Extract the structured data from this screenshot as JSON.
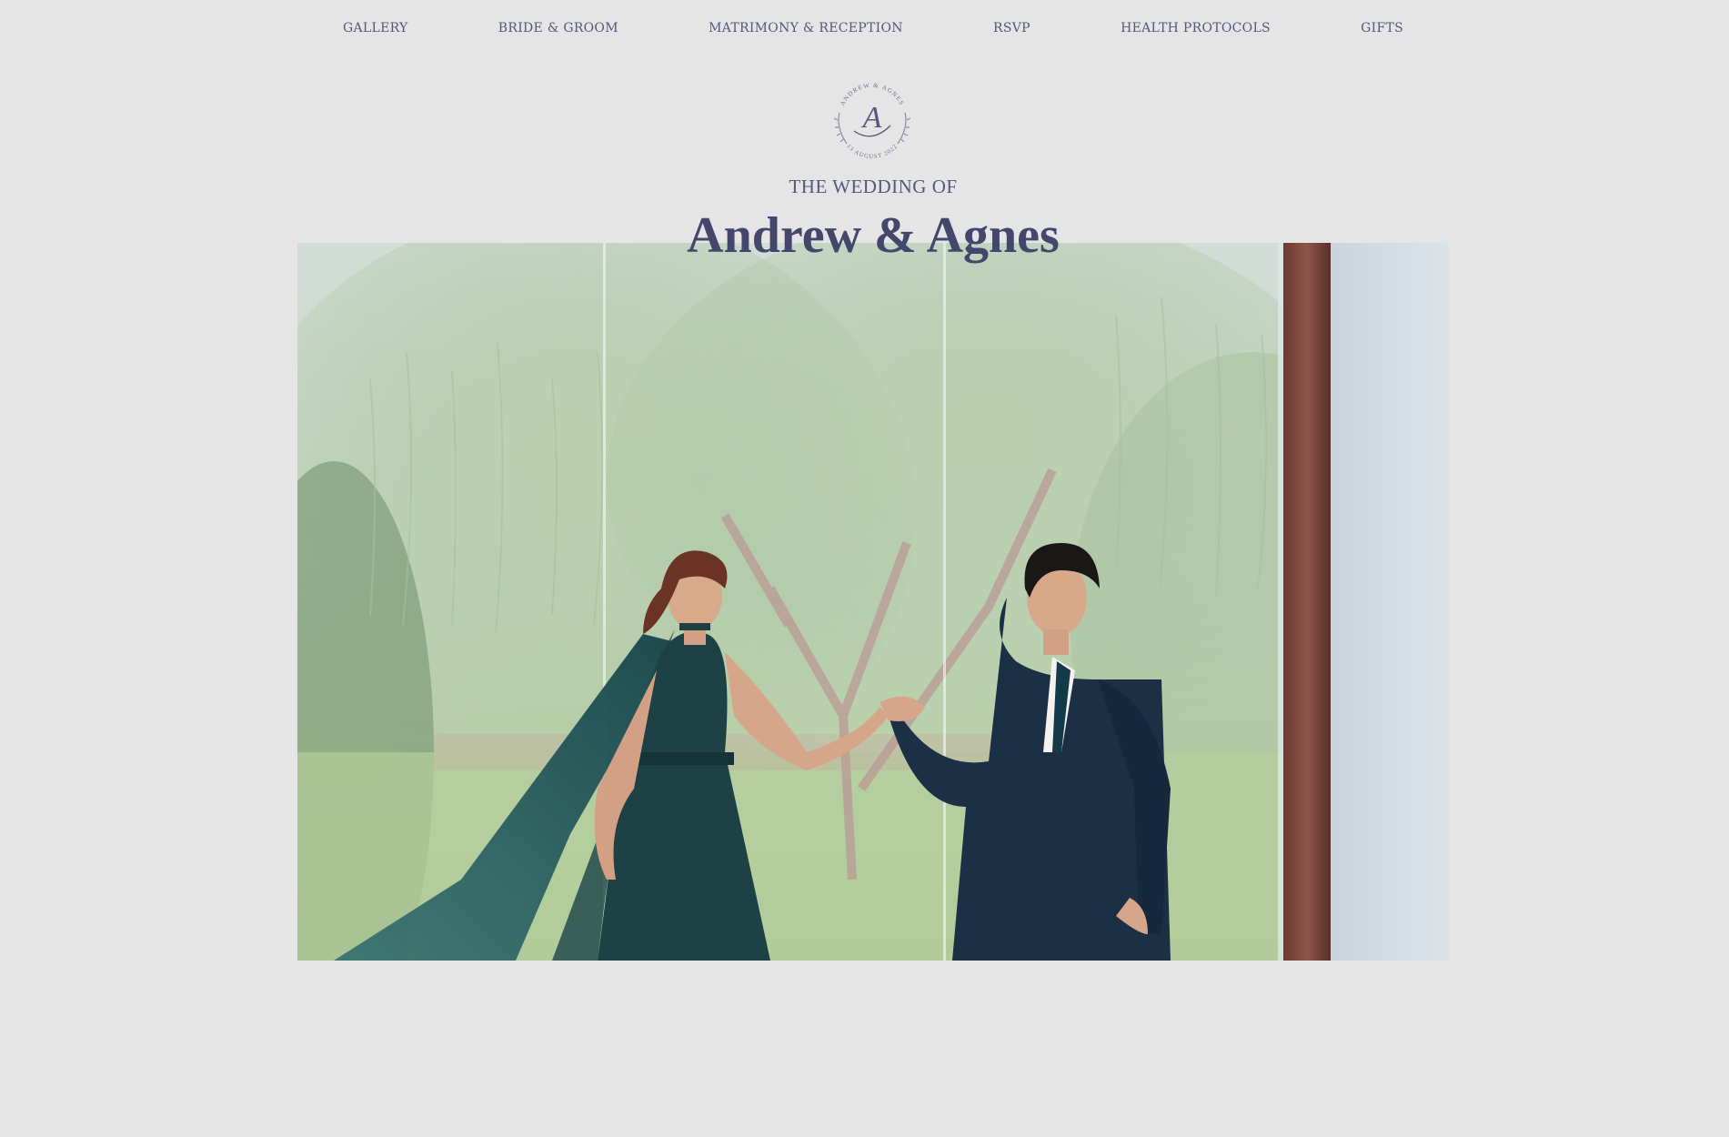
{
  "nav": {
    "items": [
      {
        "label": "GALLERY"
      },
      {
        "label": "BRIDE & GROOM"
      },
      {
        "label": "MATRIMONY & RECEPTION"
      },
      {
        "label": "RSVP"
      },
      {
        "label": "HEALTH PROTOCOLS"
      },
      {
        "label": "GIFTS"
      }
    ]
  },
  "monogram": {
    "arc_top": "ANDREW & AGNES",
    "letters": "A",
    "arc_bottom": "13 AUGUST 2022",
    "icon": "monogram-logo"
  },
  "header": {
    "subtitle": "THE WEDDING OF",
    "title": "Andrew & Agnes"
  },
  "hero": {
    "alt": "Couple holding hands in front of a window with willow trees"
  },
  "colors": {
    "background": "#e5e5e5",
    "accent": "#44466b"
  }
}
